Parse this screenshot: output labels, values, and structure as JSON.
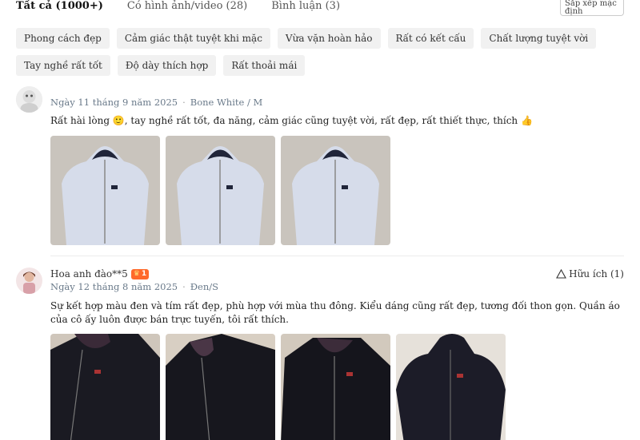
{
  "tabs": [
    {
      "label": "Tất cả (1000+)"
    },
    {
      "label": "Có hình ảnh/video (28)"
    },
    {
      "label": "Bình luận (3)"
    }
  ],
  "sort": {
    "label": "Sắp xếp mặc định"
  },
  "chips": [
    "Phong cách đẹp",
    "Cảm giác thật tuyệt khi mặc",
    "Vừa vặn hoàn hảo",
    "Rất có kết cấu",
    "Chất lượng tuyệt vời",
    "Tay nghề rất tốt",
    "Độ dày thích hợp",
    "Rất thoải mái"
  ],
  "reviews": [
    {
      "date": "Ngày 11 tháng 9 năm 2025",
      "variant": "Bone White / M",
      "text": "Rất hài lòng 🙂, tay nghề rất tốt, đa năng, cảm giác cũng tuyệt vời, rất đẹp, rất thiết thực, thích 👍",
      "photo_count": 3,
      "photo_color": "#d4dbe8"
    },
    {
      "name": "Hoa anh đào**5",
      "badge": "1",
      "date": "Ngày 12 tháng 8 năm 2025",
      "variant": "Đen/S",
      "helpful": "Hữu ích (1)",
      "text": "Sự kết hợp màu đen và tím rất đẹp, phù hợp với mùa thu đông. Kiểu dáng cũng rất đẹp, tương đối thon gọn. Quần áo của cô ấy luôn được bán trực tuyến, tôi rất thích.",
      "photo_count": 4,
      "photo_color": "#1b1b24"
    }
  ],
  "colors": {
    "accent": "#ff6a2b",
    "chip_bg": "#f1f1f1",
    "meta_text": "#6a7a8a"
  }
}
